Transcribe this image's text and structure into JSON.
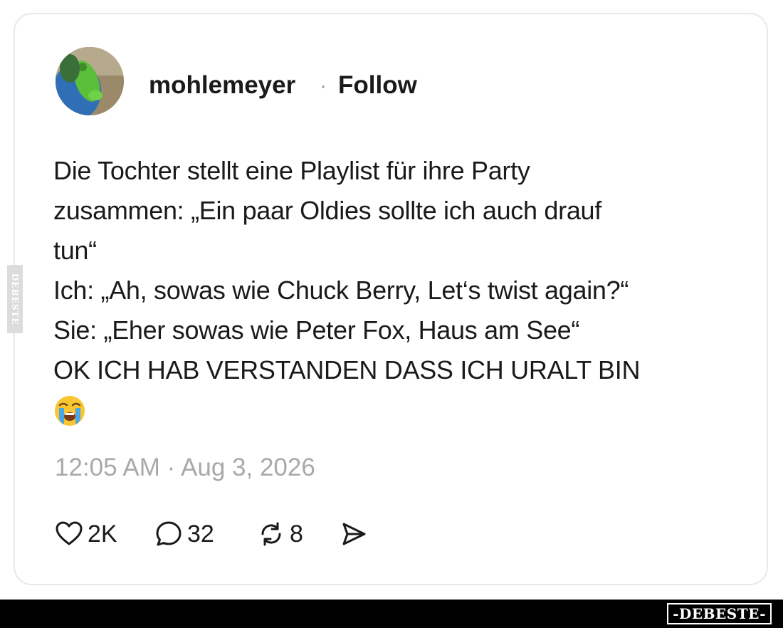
{
  "post": {
    "username": "mohlemeyer",
    "separator": "·",
    "follow_label": "Follow",
    "lines": [
      "Die Tochter stellt eine Playlist für ihre Party",
      "zusammen: „Ein paar Oldies sollte ich auch drauf",
      "tun“",
      "Ich: „Ah, sowas wie Chuck Berry, Let‘s twist again?“",
      "Sie: „Eher sowas wie Peter Fox, Haus am See“",
      "OK ICH HAB VERSTANDEN DASS ICH URALT BIN"
    ],
    "emoji": "loudly-crying-face",
    "timestamp": "12:05 AM · Aug 3, 2026"
  },
  "actions": {
    "likes": "2K",
    "comments": "32",
    "reposts": "8",
    "like_icon": "heart-icon",
    "comment_icon": "comment-bubble-icon",
    "repost_icon": "repost-icon",
    "share_icon": "send-icon"
  },
  "watermark": {
    "side": "DEBESTE",
    "brand": "-DEBESTE-"
  },
  "colors": {
    "text": "#1a1a1a",
    "muted": "#a9a9a9",
    "border": "#e8e8e8",
    "bar": "#000000"
  }
}
